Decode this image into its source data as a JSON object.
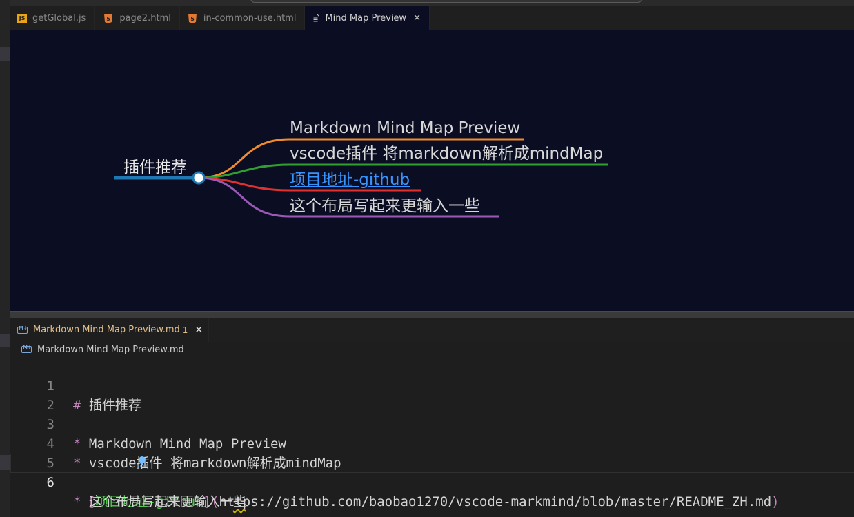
{
  "tabs": [
    {
      "label": "getGlobal.js",
      "icon": "js-file-icon"
    },
    {
      "label": "page2.html",
      "icon": "html5-file-icon"
    },
    {
      "label": "in-common-use.html",
      "icon": "html5-file-icon"
    },
    {
      "label": "Mind Map Preview",
      "icon": "preview-file-icon",
      "active": true,
      "close": "✕"
    }
  ],
  "mindmap": {
    "root": "插件推荐",
    "children": [
      {
        "label": "Markdown Mind Map Preview",
        "color": "#f28c28"
      },
      {
        "label": "vscode插件 将markdown解析成mindMap",
        "color": "#2fa02f"
      },
      {
        "label": "项目地址-github",
        "color": "#e03030",
        "link": true
      },
      {
        "label": "这个布局写起来更输入一些",
        "color": "#9b59b6"
      }
    ],
    "root_color": "#1f77b4"
  },
  "editor_tab": {
    "label": "Markdown Mind Map Preview.md",
    "badge": "1",
    "close": "✕"
  },
  "breadcrumb": "Markdown Mind Map Preview.md",
  "lines": [
    {
      "n": "1",
      "hash": "#",
      "text": " 插件推荐"
    },
    {
      "n": "2",
      "text": ""
    },
    {
      "n": "3",
      "bullet": "*",
      "text": " Markdown Mind Map Preview"
    },
    {
      "n": "4",
      "bullet": "*",
      "text": " vscode插件 将markdown解析成mindMap"
    },
    {
      "n": "5",
      "open": "[",
      "link_text": "项目地址-github",
      "mid": "](",
      "url": "https://github.com/baobao1270/vscode-markmind/blob/master/README_ZH.md",
      "close": ")"
    },
    {
      "n": "6",
      "bullet": "*",
      "text": " 这个布局写起来更输入一",
      "text_squiggle": "些"
    }
  ]
}
